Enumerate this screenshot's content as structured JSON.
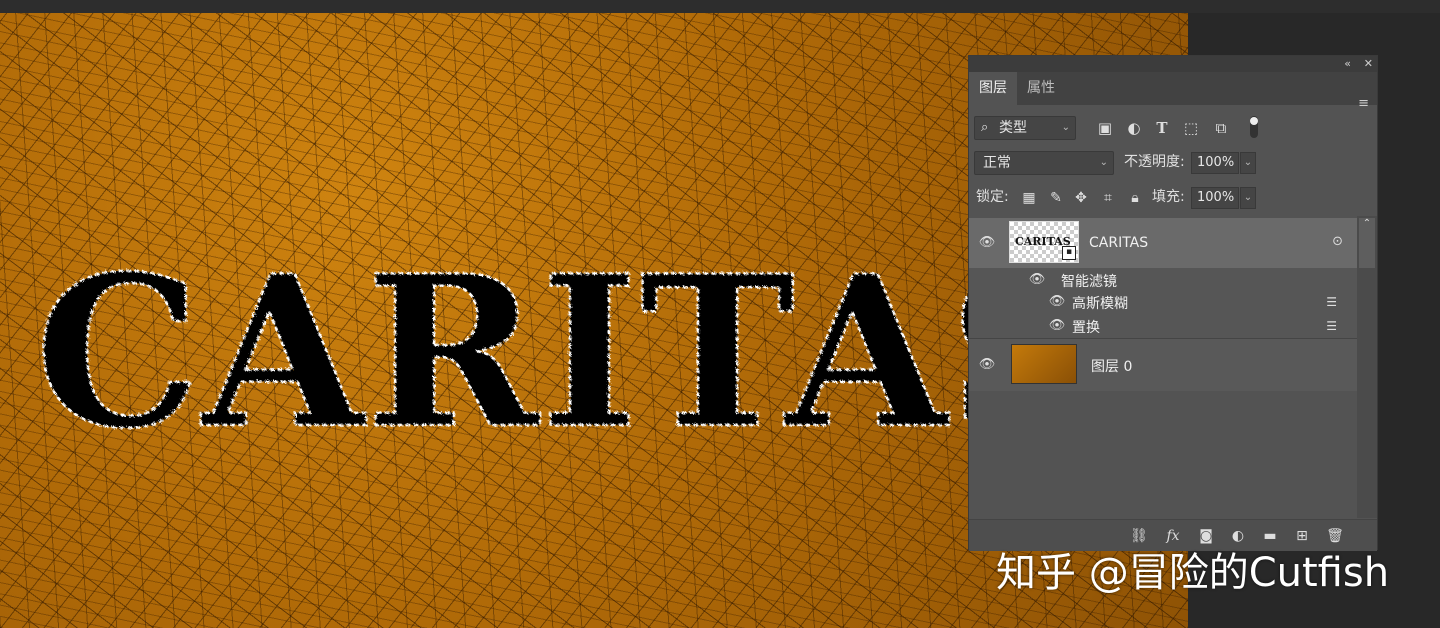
{
  "canvas": {
    "artwork_text": "CARITAS"
  },
  "panel": {
    "collapse_label": "«",
    "close_label": "✕",
    "tabs": [
      {
        "label": "图层"
      },
      {
        "label": "属性"
      }
    ],
    "menu_label": "≡",
    "filter": {
      "value": "类型",
      "icons": [
        "image-filter-icon",
        "adjustment-filter-icon",
        "type-filter-icon",
        "shape-filter-icon",
        "smart-object-filter-icon",
        "filter-toggle-icon"
      ]
    },
    "blend_mode": "正常",
    "opacity_label": "不透明度:",
    "opacity_value": "100%",
    "lock_label": "锁定:",
    "fill_label": "填充:",
    "fill_value": "100%",
    "layers": [
      {
        "name": "CARITAS",
        "thumb_text": "CARITAS",
        "smart_filters_label": "智能滤镜",
        "filters": [
          {
            "name": "高斯模糊"
          },
          {
            "name": "置换"
          }
        ]
      },
      {
        "name": "图层 0"
      }
    ]
  },
  "watermark": "知乎 @冒险的Cutfish",
  "colors": {
    "canvas_base": "#b06a08",
    "panel_bg": "#535353",
    "selected_row": "#6a6a6a"
  }
}
